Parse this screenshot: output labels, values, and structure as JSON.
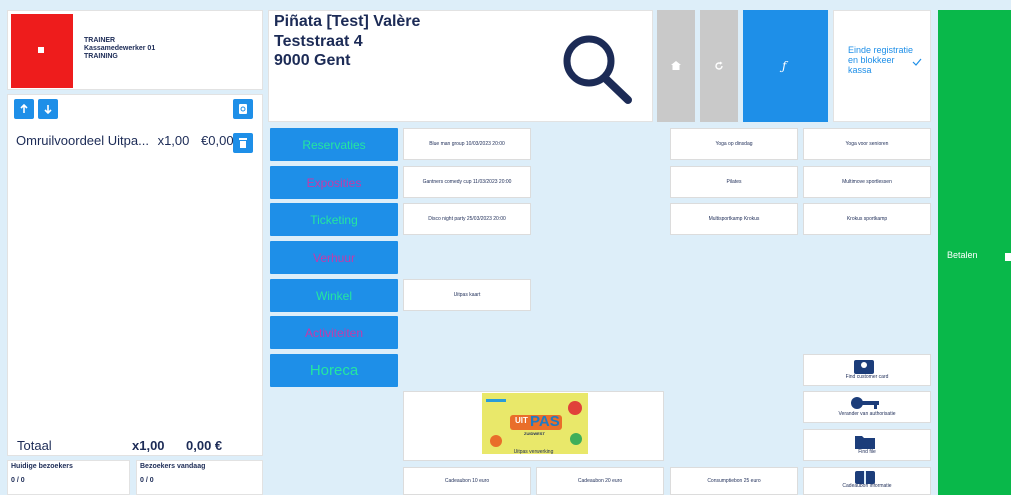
{
  "user": {
    "role": "TRAINER",
    "name": "Kassamedewerker 01",
    "mode": "TRAINING"
  },
  "order": {
    "lines": [
      {
        "name": "Omruilvoordeel Uitpa...",
        "qty": "x1,00",
        "price": "€0,00"
      }
    ],
    "total_label": "Totaal",
    "total_qty": "x1,00",
    "total_amount": "0,00 €"
  },
  "visitors": {
    "current_label": "Huidige bezoekers",
    "current_value": "0 / 0",
    "today_label": "Bezoekers vandaag",
    "today_value": "0 / 0"
  },
  "header": {
    "line1": "Piñata  [Test] Valère",
    "line2": "Teststraat 4",
    "line3": "9000 Gent",
    "einde_label": "Einde registratie en blokkeer kassa"
  },
  "pay": {
    "label": "Betalen"
  },
  "categories": [
    {
      "label": "Reservaties",
      "color": "#24e6a0"
    },
    {
      "label": "Exposities",
      "color": "#c43aa9"
    },
    {
      "label": "Ticketing",
      "color": "#24e6a0"
    },
    {
      "label": "Verhuur",
      "color": "#c43aa9"
    },
    {
      "label": "Winkel",
      "color": "#24e6a0"
    },
    {
      "label": "Activiteiten",
      "color": "#c43aa9"
    },
    {
      "label": "Horeca",
      "color": "#24e6a0"
    }
  ],
  "products": {
    "blue_man": "Blue man group 10/03/2023 20:00",
    "gantners": "Gantners comedy cup 11/03/2023 20:00",
    "disco": "Disco night party 25/03/2023 20:00",
    "uitpas_kaart": "Uitpas kaart",
    "uitpas_verwerking": "Uitpas verwerking",
    "yoga_dinsdag": "Yoga op dinsdag",
    "yoga_senioren": "Yoga voor senioren",
    "pilates": "Pilates",
    "multimove": "Multimove sportlessen",
    "multisportkamp": "Multisportkamp Krokus",
    "krokus_sportkamp": "Krokus sportkamp",
    "find_customer": "Find customer card",
    "authorisatie": "Verander van authorisatie",
    "find_file": "Find file",
    "cadeaubon_info": "Cadeaubon informatie",
    "cadeaubon10": "Cadeaubon 10 euro",
    "cadeaubon20": "Cadeaubon 20  euro",
    "consumptiebon25": "Consumptiebon 25 euro"
  },
  "uitpas_logo": {
    "uit": "UIT",
    "pas": "PAS",
    "region": "ZUIDWEST"
  },
  "icons": {
    "stop": "stop-icon",
    "up": "arrow-up-icon",
    "down": "arrow-down-icon",
    "search_doc": "document-search-icon",
    "trash": "trash-icon",
    "search": "search-icon",
    "home": "home-icon",
    "refresh": "refresh-icon",
    "function": "function-icon",
    "check": "check-icon",
    "customer": "customer-card-icon",
    "key": "key-icon",
    "folder": "folder-icon",
    "gift": "gift-icon"
  },
  "colors": {
    "accent": "#1e8fe8",
    "pay": "#09b84a",
    "stop": "#ee1c1c",
    "text": "#1c2b56"
  }
}
